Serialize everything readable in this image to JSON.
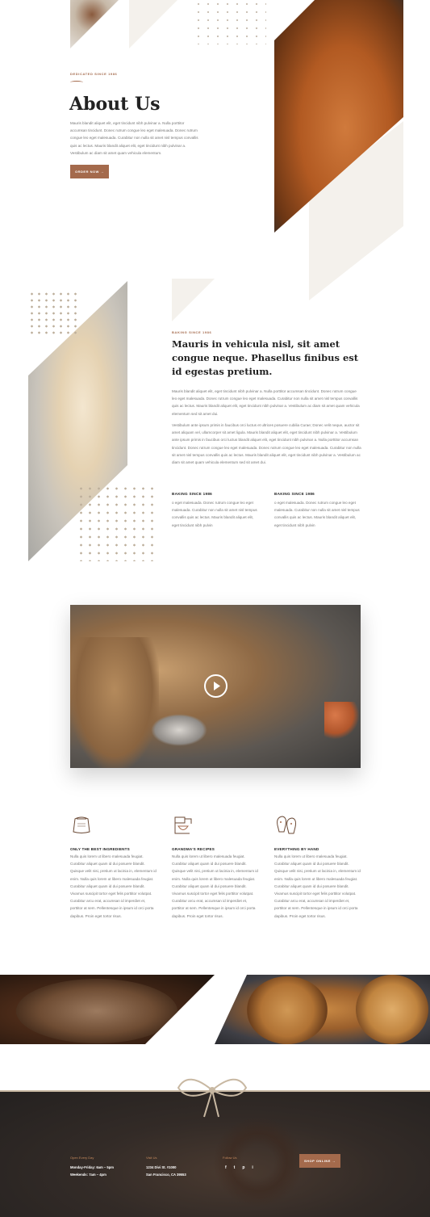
{
  "hero": {
    "eyebrow": "DEDICATED SINCE 1986",
    "title": "About Us",
    "body": "Mauris blandit aliquet elit, eget tincidunt nibh pulvinar a. Nulla porttitor accumsan tincidunt. Donec rutrum congue leo eget malesuada. Donec rutrum congue leo eget malesuada. Curabitur non nulla sit amet nisl tempus convallis quis ac lectus. Mauris blandit aliquet elit, eget tincidunt nibh pulvinar a. Vestibulum ac diam sit amet quam vehicula elementum.",
    "button": "ORDER NOW →"
  },
  "about": {
    "eyebrow": "BAKING SINCE 1986",
    "heading": "Mauris in vehicula nisl, sit amet congue neque. Phasellus finibus est id egestas pretium.",
    "para1": "Mauris blandit aliquet elit, eget tincidunt nibh pulvinar a. Nulla porttitor accumsan tincidunt. Donec rutrum congue leo eget malesuada. Donec rutrum congue leo eget malesuada. Curabitur non nulla sit amet nisl tempus convallis quis ac lectus. Mauris blandit aliquet elit, eget tincidunt nibh pulvinar a. Vestibulum ac diam sit amet quam vehicula elementum sed sit amet dui.",
    "para2": "Vestibulum ante ipsum primis in faucibus orci luctus et ultrices posuere cubilia Curae; Donec velit neque, auctor sit amet aliquam vel, ullamcorper sit amet ligula. Mauris blandit aliquet elit, eget tincidunt nibh pulvinar a. Vestibulum ante ipsum primis in faucibus orci luctus blandit aliquet elit, eget tincidunt nibh pulvinar a. Nulla porttitor accumsan tincidunt. Donec rutrum congue leo eget malesuada. Donec rutrum congue leo eget malesuada. Curabitur non nulla sit amet nisl tempus convallis quis ac lectus. Mauris blandit aliquet elit, eget tincidunt nibh pulvinar a. Vestibulum ac diam sit amet quam vehicula elementum sed sit amet dui.",
    "col1_title": "BAKING SINCE 1986",
    "col1_body": "o eget malesuada. Donec rutrum congue leo eget malesuada. Curabitur non nulla sit amet nisl tempus convallis quis ac lectus. Mauris blandit aliquet elit, eget tincidunt nibh pulvin",
    "col2_title": "BAKING SINCE 1986",
    "col2_body": "o eget malesuada. Donec rutrum congue leo eget malesuada. Curabitur non nulla sit amet nisl tempus convallis quis ac lectus. Mauris blandit aliquet elit, eget tincidunt nibh pulvin"
  },
  "video": {
    "play_icon": "play-icon"
  },
  "features": [
    {
      "icon": "flour-sack-icon",
      "title": "ONLY THE BEST INGREDIENTS",
      "body": "Nulla quis lorem ut libero malesuada feugiat. Curabitur aliquet quam id dui posuere blandit. Quisque velit nisi, pretium ut lacinia in, elementum id enim. Nulla quis lorem ut libero malesuada feugiat. Curabitur aliquet quam id dui posuere blandit. Vivamus suscipit tortor eget felis porttitor volutpat. Curabitur arcu erat, accumsan id imperdiet et, porttitor at sem. Pellentesque in ipsum id orci porta dapibus. Proin eget tortor risus."
    },
    {
      "icon": "mixer-icon",
      "title": "GRANDMA'S RECIPES",
      "body": "Nulla quis lorem ut libero malesuada feugiat. Curabitur aliquet quam id dui posuere blandit. Quisque velit nisi, pretium ut lacinia in, elementum id enim. Nulla quis lorem ut libero malesuada feugiat. Curabitur aliquet quam id dui posuere blandit. Vivamus suscipit tortor eget felis porttitor volutpat. Curabitur arcu erat, accumsan id imperdiet et, porttitor at sem. Pellentesque in ipsum id orci porta dapibus. Proin eget tortor risus."
    },
    {
      "icon": "oven-mitts-icon",
      "title": "EVERYTHING BY HAND",
      "body": "Nulla quis lorem ut libero malesuada feugiat. Curabitur aliquet quam id dui posuere blandit. Quisque velit nisi, pretium ut lacinia in, elementum id enim. Nulla quis lorem ut libero malesuada feugiat. Curabitur aliquet quam id dui posuere blandit. Vivamus suscipit tortor eget felis porttitor volutpat. Curabitur arcu erat, accumsan id imperdiet et, porttitor at sem. Pellentesque in ipsum id orci porta dapibus. Proin eget tortor risus."
    }
  ],
  "footer": {
    "hours_label": "Open Every Day",
    "hours_line1": "Monday-Friday: 6am – 5pm",
    "hours_line2": "Weekends: 7am – 4pm",
    "visit_label": "Visit Us",
    "visit_line1": "1234 Divi St. #1000",
    "visit_line2": "San Francisco, CA 39553",
    "follow_label": "Follow Us",
    "social": [
      "f",
      "t",
      "p",
      "i"
    ],
    "shop_button": "SHOP ONLINE →"
  },
  "colors": {
    "accent": "#a46a4c",
    "cream": "#f4f1ec",
    "footer_bg": "#2a2524"
  }
}
